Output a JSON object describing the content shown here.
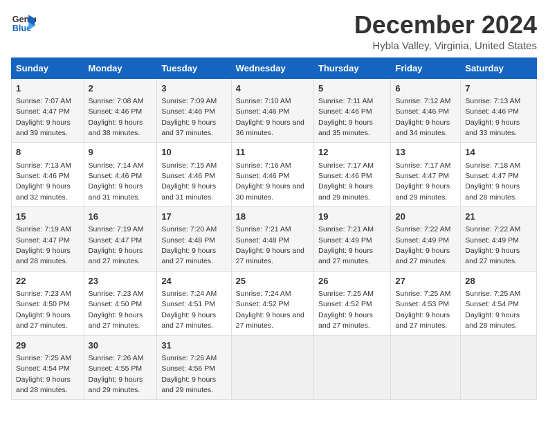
{
  "logo": {
    "line1": "General",
    "line2": "Blue"
  },
  "title": "December 2024",
  "subtitle": "Hybla Valley, Virginia, United States",
  "days_header": [
    "Sunday",
    "Monday",
    "Tuesday",
    "Wednesday",
    "Thursday",
    "Friday",
    "Saturday"
  ],
  "weeks": [
    [
      {
        "day": "1",
        "sunrise": "Sunrise: 7:07 AM",
        "sunset": "Sunset: 4:47 PM",
        "daylight": "Daylight: 9 hours and 39 minutes."
      },
      {
        "day": "2",
        "sunrise": "Sunrise: 7:08 AM",
        "sunset": "Sunset: 4:46 PM",
        "daylight": "Daylight: 9 hours and 38 minutes."
      },
      {
        "day": "3",
        "sunrise": "Sunrise: 7:09 AM",
        "sunset": "Sunset: 4:46 PM",
        "daylight": "Daylight: 9 hours and 37 minutes."
      },
      {
        "day": "4",
        "sunrise": "Sunrise: 7:10 AM",
        "sunset": "Sunset: 4:46 PM",
        "daylight": "Daylight: 9 hours and 36 minutes."
      },
      {
        "day": "5",
        "sunrise": "Sunrise: 7:11 AM",
        "sunset": "Sunset: 4:46 PM",
        "daylight": "Daylight: 9 hours and 35 minutes."
      },
      {
        "day": "6",
        "sunrise": "Sunrise: 7:12 AM",
        "sunset": "Sunset: 4:46 PM",
        "daylight": "Daylight: 9 hours and 34 minutes."
      },
      {
        "day": "7",
        "sunrise": "Sunrise: 7:13 AM",
        "sunset": "Sunset: 4:46 PM",
        "daylight": "Daylight: 9 hours and 33 minutes."
      }
    ],
    [
      {
        "day": "8",
        "sunrise": "Sunrise: 7:13 AM",
        "sunset": "Sunset: 4:46 PM",
        "daylight": "Daylight: 9 hours and 32 minutes."
      },
      {
        "day": "9",
        "sunrise": "Sunrise: 7:14 AM",
        "sunset": "Sunset: 4:46 PM",
        "daylight": "Daylight: 9 hours and 31 minutes."
      },
      {
        "day": "10",
        "sunrise": "Sunrise: 7:15 AM",
        "sunset": "Sunset: 4:46 PM",
        "daylight": "Daylight: 9 hours and 31 minutes."
      },
      {
        "day": "11",
        "sunrise": "Sunrise: 7:16 AM",
        "sunset": "Sunset: 4:46 PM",
        "daylight": "Daylight: 9 hours and 30 minutes."
      },
      {
        "day": "12",
        "sunrise": "Sunrise: 7:17 AM",
        "sunset": "Sunset: 4:46 PM",
        "daylight": "Daylight: 9 hours and 29 minutes."
      },
      {
        "day": "13",
        "sunrise": "Sunrise: 7:17 AM",
        "sunset": "Sunset: 4:47 PM",
        "daylight": "Daylight: 9 hours and 29 minutes."
      },
      {
        "day": "14",
        "sunrise": "Sunrise: 7:18 AM",
        "sunset": "Sunset: 4:47 PM",
        "daylight": "Daylight: 9 hours and 28 minutes."
      }
    ],
    [
      {
        "day": "15",
        "sunrise": "Sunrise: 7:19 AM",
        "sunset": "Sunset: 4:47 PM",
        "daylight": "Daylight: 9 hours and 28 minutes."
      },
      {
        "day": "16",
        "sunrise": "Sunrise: 7:19 AM",
        "sunset": "Sunset: 4:47 PM",
        "daylight": "Daylight: 9 hours and 27 minutes."
      },
      {
        "day": "17",
        "sunrise": "Sunrise: 7:20 AM",
        "sunset": "Sunset: 4:48 PM",
        "daylight": "Daylight: 9 hours and 27 minutes."
      },
      {
        "day": "18",
        "sunrise": "Sunrise: 7:21 AM",
        "sunset": "Sunset: 4:48 PM",
        "daylight": "Daylight: 9 hours and 27 minutes."
      },
      {
        "day": "19",
        "sunrise": "Sunrise: 7:21 AM",
        "sunset": "Sunset: 4:49 PM",
        "daylight": "Daylight: 9 hours and 27 minutes."
      },
      {
        "day": "20",
        "sunrise": "Sunrise: 7:22 AM",
        "sunset": "Sunset: 4:49 PM",
        "daylight": "Daylight: 9 hours and 27 minutes."
      },
      {
        "day": "21",
        "sunrise": "Sunrise: 7:22 AM",
        "sunset": "Sunset: 4:49 PM",
        "daylight": "Daylight: 9 hours and 27 minutes."
      }
    ],
    [
      {
        "day": "22",
        "sunrise": "Sunrise: 7:23 AM",
        "sunset": "Sunset: 4:50 PM",
        "daylight": "Daylight: 9 hours and 27 minutes."
      },
      {
        "day": "23",
        "sunrise": "Sunrise: 7:23 AM",
        "sunset": "Sunset: 4:50 PM",
        "daylight": "Daylight: 9 hours and 27 minutes."
      },
      {
        "day": "24",
        "sunrise": "Sunrise: 7:24 AM",
        "sunset": "Sunset: 4:51 PM",
        "daylight": "Daylight: 9 hours and 27 minutes."
      },
      {
        "day": "25",
        "sunrise": "Sunrise: 7:24 AM",
        "sunset": "Sunset: 4:52 PM",
        "daylight": "Daylight: 9 hours and 27 minutes."
      },
      {
        "day": "26",
        "sunrise": "Sunrise: 7:25 AM",
        "sunset": "Sunset: 4:52 PM",
        "daylight": "Daylight: 9 hours and 27 minutes."
      },
      {
        "day": "27",
        "sunrise": "Sunrise: 7:25 AM",
        "sunset": "Sunset: 4:53 PM",
        "daylight": "Daylight: 9 hours and 27 minutes."
      },
      {
        "day": "28",
        "sunrise": "Sunrise: 7:25 AM",
        "sunset": "Sunset: 4:54 PM",
        "daylight": "Daylight: 9 hours and 28 minutes."
      }
    ],
    [
      {
        "day": "29",
        "sunrise": "Sunrise: 7:25 AM",
        "sunset": "Sunset: 4:54 PM",
        "daylight": "Daylight: 9 hours and 28 minutes."
      },
      {
        "day": "30",
        "sunrise": "Sunrise: 7:26 AM",
        "sunset": "Sunset: 4:55 PM",
        "daylight": "Daylight: 9 hours and 29 minutes."
      },
      {
        "day": "31",
        "sunrise": "Sunrise: 7:26 AM",
        "sunset": "Sunset: 4:56 PM",
        "daylight": "Daylight: 9 hours and 29 minutes."
      },
      null,
      null,
      null,
      null
    ]
  ]
}
